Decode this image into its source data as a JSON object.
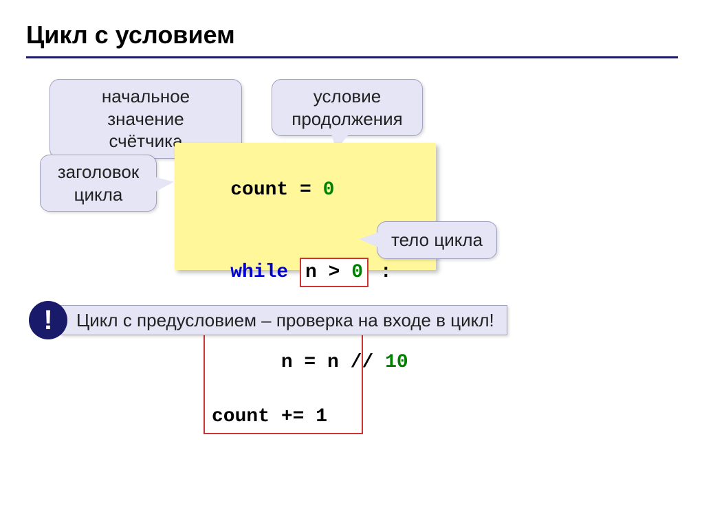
{
  "title": "Цикл с условием",
  "callouts": {
    "initial": "начальное значение\nсчётчика",
    "condition": "условие\nпродолжения",
    "header": "заголовок\nцикла",
    "body": "тело цикла"
  },
  "code": {
    "count_kw": "count",
    "assign": " = ",
    "zero": "0",
    "while_kw": "while",
    "cond_pre": "n > ",
    "cond_zero": "0",
    "colon": " :",
    "body_line1_pre": "n = n // ",
    "body_line1_num": "10",
    "body_line2": "count += 1"
  },
  "note": {
    "mark": "!",
    "text": "Цикл с предусловием – проверка на входе в цикл!"
  }
}
